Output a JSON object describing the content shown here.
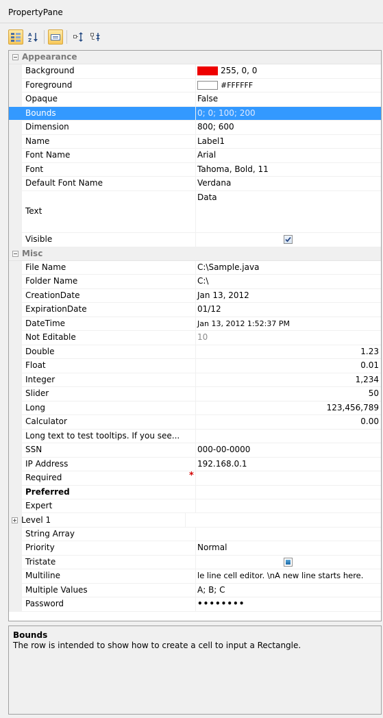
{
  "window": {
    "title": "PropertyPane"
  },
  "toolbar": {
    "buttons": [
      {
        "icon": "categorized-icon",
        "active": true
      },
      {
        "icon": "sort-alphabetical-icon",
        "active": false
      },
      {
        "icon": "description-toggle-icon",
        "active": true
      },
      {
        "icon": "expand-all-icon",
        "active": false
      },
      {
        "icon": "collapse-all-icon",
        "active": false
      }
    ]
  },
  "categories": {
    "appearance": "Appearance",
    "misc": "Misc"
  },
  "appearance": {
    "background": {
      "name": "Background",
      "value": "255, 0, 0",
      "color": "#ee0000"
    },
    "foreground": {
      "name": "Foreground",
      "value": "#FFFFFF",
      "color": "#ffffff"
    },
    "opaque": {
      "name": "Opaque",
      "value": "False"
    },
    "bounds": {
      "name": "Bounds",
      "value": "0; 0; 100; 200"
    },
    "dimension": {
      "name": "Dimension",
      "value": "800; 600"
    },
    "name": {
      "name": "Name",
      "value": "Label1"
    },
    "font_name": {
      "name": "Font Name",
      "value": "Arial"
    },
    "font": {
      "name": "Font",
      "value": "Tahoma, Bold, 11"
    },
    "default_font_name": {
      "name": "Default Font Name",
      "value": "Verdana"
    },
    "text": {
      "name": "Text",
      "value": "Data"
    },
    "visible": {
      "name": "Visible",
      "checked": true
    }
  },
  "misc": {
    "file_name": {
      "name": "File Name",
      "value": "C:\\Sample.java"
    },
    "folder_name": {
      "name": "Folder Name",
      "value": "C:\\"
    },
    "creation_date": {
      "name": "CreationDate",
      "value": "Jan 13, 2012"
    },
    "expiration_date": {
      "name": "ExpirationDate",
      "value": "01/12"
    },
    "date_time": {
      "name": "DateTime",
      "value": "Jan 13, 2012 1:52:37 PM"
    },
    "not_editable": {
      "name": "Not Editable",
      "value": "10"
    },
    "double": {
      "name": "Double",
      "value": "1.23"
    },
    "float": {
      "name": "Float",
      "value": "0.01"
    },
    "integer": {
      "name": "Integer",
      "value": "1,234"
    },
    "slider": {
      "name": "Slider",
      "value": "50"
    },
    "long": {
      "name": "Long",
      "value": "123,456,789"
    },
    "calculator": {
      "name": "Calculator",
      "value": "0.00"
    },
    "long_text": {
      "name": "Long text to test tooltips. If you see...",
      "value": ""
    },
    "ssn": {
      "name": "SSN",
      "value": "000-00-0000"
    },
    "ip": {
      "name": "IP Address",
      "value": "192.168.0.1"
    },
    "required": {
      "name": "Required",
      "marker": "*"
    },
    "preferred": {
      "name": "Preferred"
    },
    "expert": {
      "name": "Expert",
      "color": "#0000ee"
    },
    "level1": {
      "name": "Level 1"
    },
    "string_array": {
      "name": "String Array",
      "value": ""
    },
    "priority": {
      "name": "Priority",
      "value": "Normal"
    },
    "tristate": {
      "name": "Tristate"
    },
    "multiline": {
      "name": "Multiline",
      "value": "le line cell editor. \\nA new line starts here."
    },
    "multiple_values": {
      "name": "Multiple Values",
      "value": "A; B; C"
    },
    "password": {
      "name": "Password",
      "value": "••••••••"
    }
  },
  "description": {
    "title": "Bounds",
    "text": "The row is intended to show how to create a cell to input a Rectangle."
  },
  "colors": {
    "selection": "#3399ff",
    "gutter": "#f0f0f0",
    "category_text": "#7a7a7a",
    "required_marker": "#d40000"
  }
}
